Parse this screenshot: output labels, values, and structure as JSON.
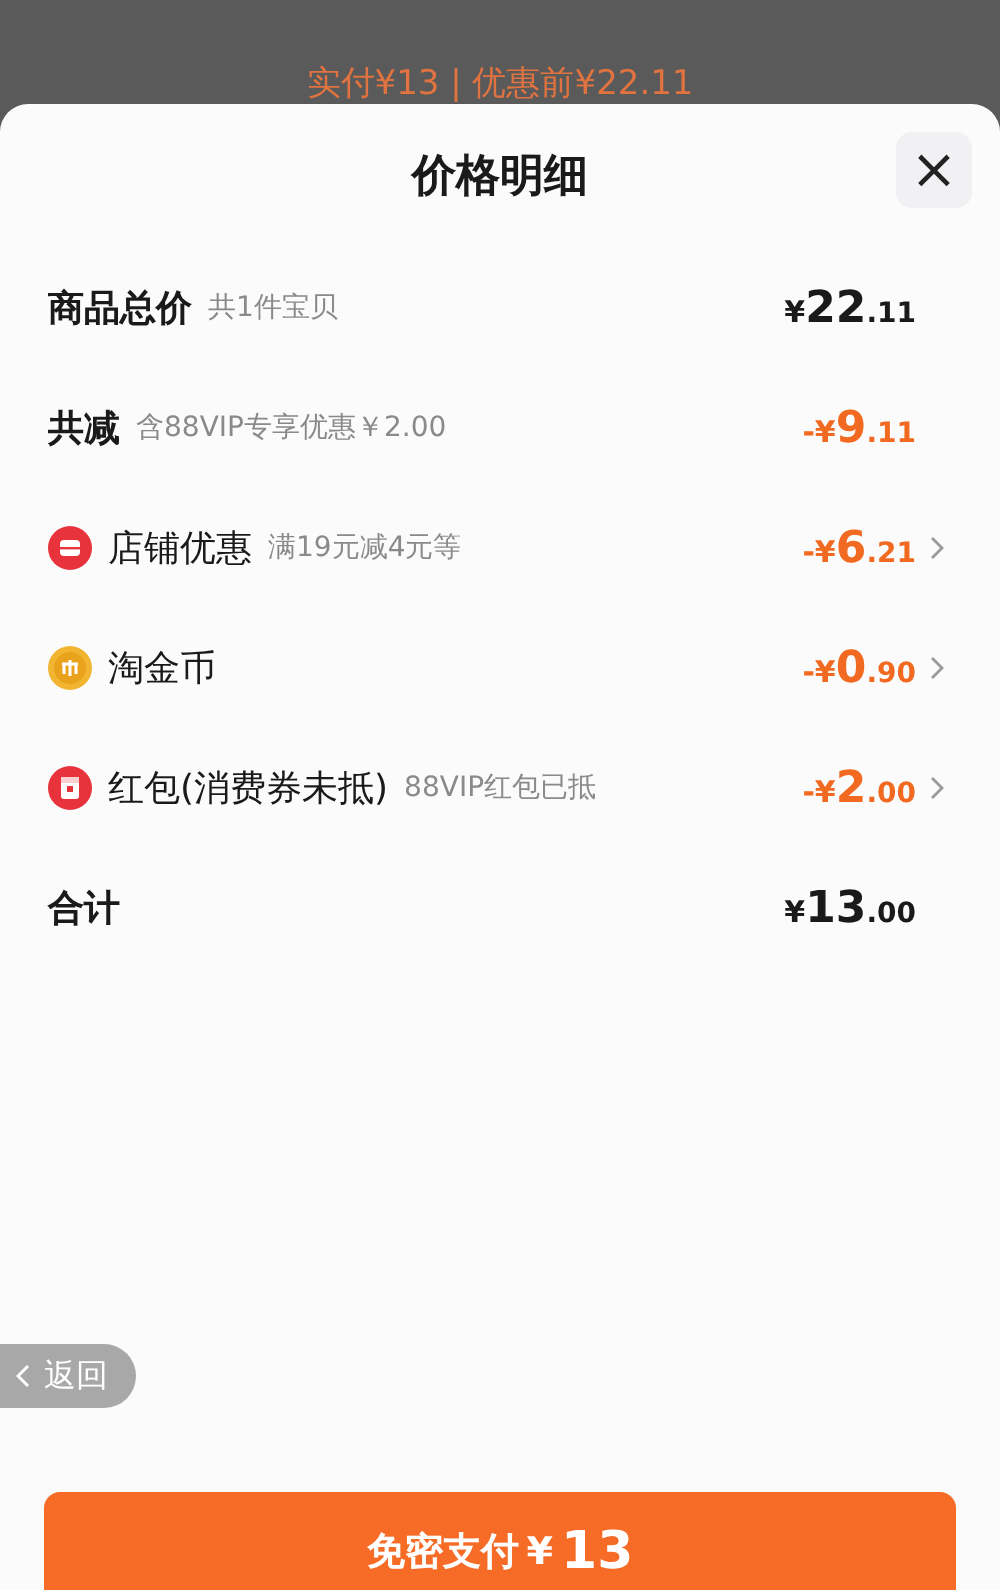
{
  "background": {
    "summary": "实付¥13 | 优惠前¥22.11"
  },
  "sheet": {
    "title": "价格明细",
    "close": "×"
  },
  "rows": [
    {
      "kind": "subtotal",
      "label": "商品总价",
      "note": "共1件宝贝",
      "amount": {
        "currency": "¥",
        "integer": "22",
        "decimal": ".11"
      }
    },
    {
      "kind": "reduction",
      "label": "共减",
      "note": "含88VIP专享优惠￥2.00",
      "amount": {
        "currency": "-¥",
        "integer": "9",
        "decimal": ".11"
      }
    },
    {
      "kind": "shop",
      "label": "店铺优惠",
      "note": "满19元减4元等",
      "amount": {
        "currency": "-¥",
        "integer": "6",
        "decimal": ".21"
      }
    },
    {
      "kind": "coin",
      "label": "淘金币",
      "amount": {
        "currency": "-¥",
        "integer": "0",
        "decimal": ".90"
      }
    },
    {
      "kind": "packet",
      "label": "红包(消费券未抵)",
      "note": "88VIP红包已抵",
      "amount": {
        "currency": "-¥",
        "integer": "2",
        "decimal": ".00"
      }
    },
    {
      "kind": "total",
      "label": "合计",
      "amount": {
        "currency": "¥",
        "integer": "13",
        "decimal": ".00"
      }
    }
  ],
  "back_button": {
    "label": "返回"
  },
  "pay_button": {
    "label": "免密支付",
    "currency": "¥",
    "amount": "13"
  }
}
